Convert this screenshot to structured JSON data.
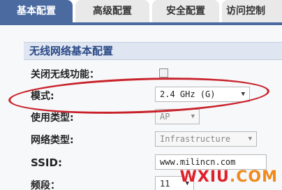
{
  "tabs": [
    {
      "label": "基本配置",
      "active": true
    },
    {
      "label": "高级配置",
      "active": false
    },
    {
      "label": "安全配置",
      "active": false
    },
    {
      "label": "访问控制",
      "active": false
    }
  ],
  "section": {
    "title": "无线网络基本配置"
  },
  "fields": {
    "disable_wireless": {
      "label": "关闭无线功能",
      "colon": "：",
      "checked": false
    },
    "mode": {
      "label": "模式:",
      "value": "2.4 GHz (G)"
    },
    "usage_type": {
      "label": "使用类型:",
      "value": "AP"
    },
    "network_type": {
      "label": "网络类型:",
      "value": "Infrastructure"
    },
    "ssid": {
      "label": "SSID:",
      "value": "www.milincn.com"
    },
    "band": {
      "label": "频段：",
      "value": "11"
    }
  },
  "watermark": {
    "part1": "WXIU",
    "part2": ".COM"
  },
  "colors": {
    "tab_active": "#4a6aa0",
    "section_bg": "#dfe6f2",
    "highlight": "#c8222a"
  }
}
